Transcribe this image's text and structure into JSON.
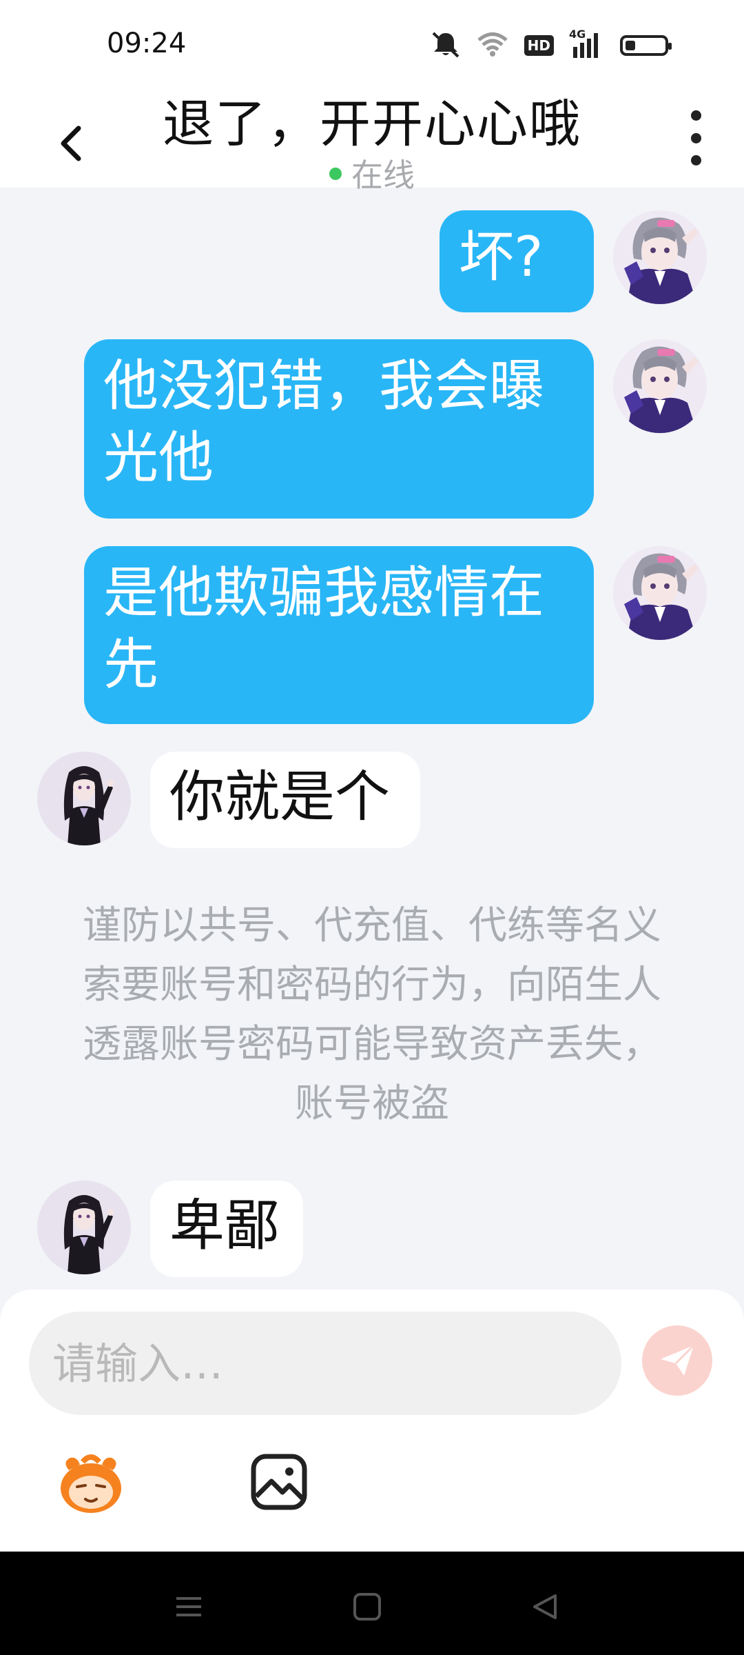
{
  "status_bar": {
    "time": "09:24",
    "hd_badge": "HD",
    "network": "4G",
    "battery_level": 0.25
  },
  "header": {
    "title": "退了，开开心心哦",
    "status": "在线"
  },
  "messages": [
    {
      "direction": "outgoing",
      "text": "坏?"
    },
    {
      "direction": "outgoing",
      "text": "他没犯错，我会曝光他"
    },
    {
      "direction": "outgoing",
      "text": "是他欺骗我感情在先"
    },
    {
      "direction": "incoming",
      "text": "你就是个"
    },
    {
      "direction": "incoming",
      "text": "卑鄙"
    }
  ],
  "system_notice": "谨防以共号、代充值、代练等名义索要账号和密码的行为，向陌生人透露账号密码可能导致资产丢失，账号被盗",
  "composer": {
    "placeholder": "请输入…"
  },
  "colors": {
    "outgoing_bubble": "#29b6f6",
    "incoming_bubble": "#ffffff",
    "background": "#f2f4f8",
    "online_dot": "#3cc860",
    "send_button": "#fbd3ce"
  },
  "icons": [
    "mute-icon",
    "wifi-icon",
    "signal-icon",
    "battery-icon",
    "back-icon",
    "more-icon",
    "send-icon",
    "emoji-icon",
    "image-icon",
    "nav-menu-icon",
    "nav-home-icon",
    "nav-back-icon"
  ]
}
